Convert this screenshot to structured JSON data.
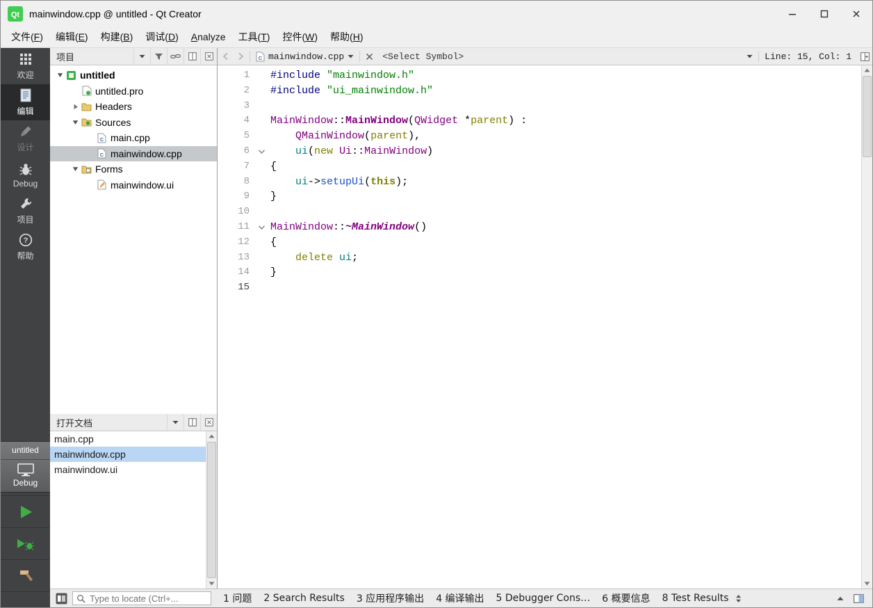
{
  "window": {
    "title": "mainwindow.cpp @ untitled - Qt Creator"
  },
  "menubar": {
    "items": [
      {
        "label": "文件(F)",
        "mnemonic": "F"
      },
      {
        "label": "编辑(E)",
        "mnemonic": "E"
      },
      {
        "label": "构建(B)",
        "mnemonic": "B"
      },
      {
        "label": "调试(D)",
        "mnemonic": "D"
      },
      {
        "label": "Analyze",
        "mnemonic": "A"
      },
      {
        "label": "工具(T)",
        "mnemonic": "T"
      },
      {
        "label": "控件(W)",
        "mnemonic": "W"
      },
      {
        "label": "帮助(H)",
        "mnemonic": "H"
      }
    ]
  },
  "modebar": {
    "modes": [
      {
        "name": "welcome",
        "label": "欢迎",
        "icon": "welcome-icon",
        "selected": false,
        "enabled": true
      },
      {
        "name": "edit",
        "label": "编辑",
        "icon": "edit-icon",
        "selected": true,
        "enabled": true
      },
      {
        "name": "design",
        "label": "设计",
        "icon": "design-icon",
        "selected": false,
        "enabled": false
      },
      {
        "name": "debug",
        "label": "Debug",
        "icon": "debug-icon",
        "selected": false,
        "enabled": true
      },
      {
        "name": "projects",
        "label": "项目",
        "icon": "projects-icon",
        "selected": false,
        "enabled": true
      },
      {
        "name": "help",
        "label": "帮助",
        "icon": "help-icon",
        "selected": false,
        "enabled": true
      }
    ],
    "kit_selector": {
      "project": "untitled",
      "target": "Debug"
    },
    "actions": [
      {
        "name": "run",
        "icon": "run-icon"
      },
      {
        "name": "start-debugging",
        "icon": "debug-run-icon"
      },
      {
        "name": "build",
        "icon": "build-icon"
      }
    ]
  },
  "projects_panel": {
    "title": "项目",
    "toolbar_icons": [
      "caret-down-icon",
      "filter-icon",
      "link-icon",
      "split-icon",
      "close-panel-icon"
    ],
    "tree": [
      {
        "label": "untitled",
        "level": 0,
        "expander": "down",
        "icon": "project-icon",
        "bold": true,
        "selected": false
      },
      {
        "label": "untitled.pro",
        "level": 1,
        "expander": "none",
        "icon": "profile-icon",
        "bold": false,
        "selected": false
      },
      {
        "label": "Headers",
        "level": 1,
        "expander": "right",
        "icon": "headers-folder-icon",
        "bold": false,
        "selected": false
      },
      {
        "label": "Sources",
        "level": 1,
        "expander": "down",
        "icon": "sources-folder-icon",
        "bold": false,
        "selected": false
      },
      {
        "label": "main.cpp",
        "level": 2,
        "expander": "none",
        "icon": "cpp-file-icon",
        "bold": false,
        "selected": false
      },
      {
        "label": "mainwindow.cpp",
        "level": 2,
        "expander": "none",
        "icon": "cpp-file-icon",
        "bold": false,
        "selected": true
      },
      {
        "label": "Forms",
        "level": 1,
        "expander": "down",
        "icon": "forms-folder-icon",
        "bold": false,
        "selected": false
      },
      {
        "label": "mainwindow.ui",
        "level": 2,
        "expander": "none",
        "icon": "ui-file-icon",
        "bold": false,
        "selected": false
      }
    ]
  },
  "open_documents_panel": {
    "title": "打开文档",
    "toolbar_icons": [
      "caret-down-icon",
      "split-icon",
      "close-panel-icon"
    ],
    "items": [
      {
        "label": "main.cpp",
        "selected": false
      },
      {
        "label": "mainwindow.cpp",
        "selected": true
      },
      {
        "label": "mainwindow.ui",
        "selected": false
      }
    ]
  },
  "editor": {
    "toolbar": {
      "file_name": "mainwindow.cpp",
      "symbol_selector": "<Select Symbol>",
      "cursor_position": "Line: 15, Col: 1"
    },
    "code_lines": [
      {
        "n": "1",
        "fold": "",
        "current": false,
        "t": [
          [
            "pp",
            "#include"
          ],
          [
            "pl",
            " "
          ],
          [
            "str",
            "\"mainwindow.h\""
          ]
        ]
      },
      {
        "n": "2",
        "fold": "",
        "current": false,
        "t": [
          [
            "pp",
            "#include"
          ],
          [
            "pl",
            " "
          ],
          [
            "str",
            "\"ui_mainwindow.h\""
          ]
        ]
      },
      {
        "n": "3",
        "fold": "",
        "current": false,
        "t": []
      },
      {
        "n": "4",
        "fold": "",
        "current": false,
        "t": [
          [
            "typ",
            "MainWindow"
          ],
          [
            "pl",
            "::"
          ],
          [
            "fndef",
            "MainWindow"
          ],
          [
            "pl",
            "("
          ],
          [
            "typ",
            "QWidget"
          ],
          [
            "pl",
            " *"
          ],
          [
            "kw",
            "parent"
          ],
          [
            "pl",
            ") :"
          ]
        ]
      },
      {
        "n": "5",
        "fold": "",
        "current": false,
        "t": [
          [
            "pl",
            "    "
          ],
          [
            "typ",
            "QMainWindow"
          ],
          [
            "pl",
            "("
          ],
          [
            "kw",
            "parent"
          ],
          [
            "pl",
            "),"
          ]
        ]
      },
      {
        "n": "6",
        "fold": "down",
        "current": false,
        "t": [
          [
            "pl",
            "    "
          ],
          [
            "fld",
            "ui"
          ],
          [
            "pl",
            "("
          ],
          [
            "kw",
            "new"
          ],
          [
            "pl",
            " "
          ],
          [
            "typ",
            "Ui"
          ],
          [
            "pl",
            "::"
          ],
          [
            "typ",
            "MainWindow"
          ],
          [
            "pl",
            ")"
          ]
        ]
      },
      {
        "n": "7",
        "fold": "",
        "current": false,
        "t": [
          [
            "pl",
            "{"
          ]
        ]
      },
      {
        "n": "8",
        "fold": "",
        "current": false,
        "t": [
          [
            "pl",
            "    "
          ],
          [
            "fld",
            "ui"
          ],
          [
            "pl",
            "->"
          ],
          [
            "fnc",
            "setupUi"
          ],
          [
            "pl",
            "("
          ],
          [
            "kwb",
            "this"
          ],
          [
            "pl",
            ");"
          ]
        ]
      },
      {
        "n": "9",
        "fold": "",
        "current": false,
        "t": [
          [
            "pl",
            "}"
          ]
        ]
      },
      {
        "n": "10",
        "fold": "",
        "current": false,
        "t": []
      },
      {
        "n": "11",
        "fold": "down",
        "current": false,
        "t": [
          [
            "typ",
            "MainWindow"
          ],
          [
            "pl",
            "::"
          ],
          [
            "virt",
            "~MainWindow"
          ],
          [
            "pl",
            "()"
          ]
        ]
      },
      {
        "n": "12",
        "fold": "",
        "current": false,
        "t": [
          [
            "pl",
            "{"
          ]
        ]
      },
      {
        "n": "13",
        "fold": "",
        "current": false,
        "t": [
          [
            "pl",
            "    "
          ],
          [
            "kw",
            "delete"
          ],
          [
            "pl",
            " "
          ],
          [
            "fld",
            "ui"
          ],
          [
            "pl",
            ";"
          ]
        ]
      },
      {
        "n": "14",
        "fold": "",
        "current": false,
        "t": [
          [
            "pl",
            "}"
          ]
        ]
      },
      {
        "n": "15",
        "fold": "",
        "current": true,
        "t": []
      }
    ]
  },
  "statusbar": {
    "locator": {
      "placeholder": "Type to locate (Ctrl+..."
    },
    "output_panes": [
      "1 问题",
      "2 Search Results",
      "3 应用程序输出",
      "4 编译输出",
      "5 Debugger Cons…",
      "6 概要信息",
      "8 Test Results"
    ]
  },
  "syntax_colors": {
    "preprocessor": "#000080",
    "string": "#008000",
    "type": "#800080",
    "keyword": "#808000",
    "field": "#008080",
    "function": "#1a4fc4",
    "plain": "#000000",
    "line_number": "#9d9d9d"
  }
}
